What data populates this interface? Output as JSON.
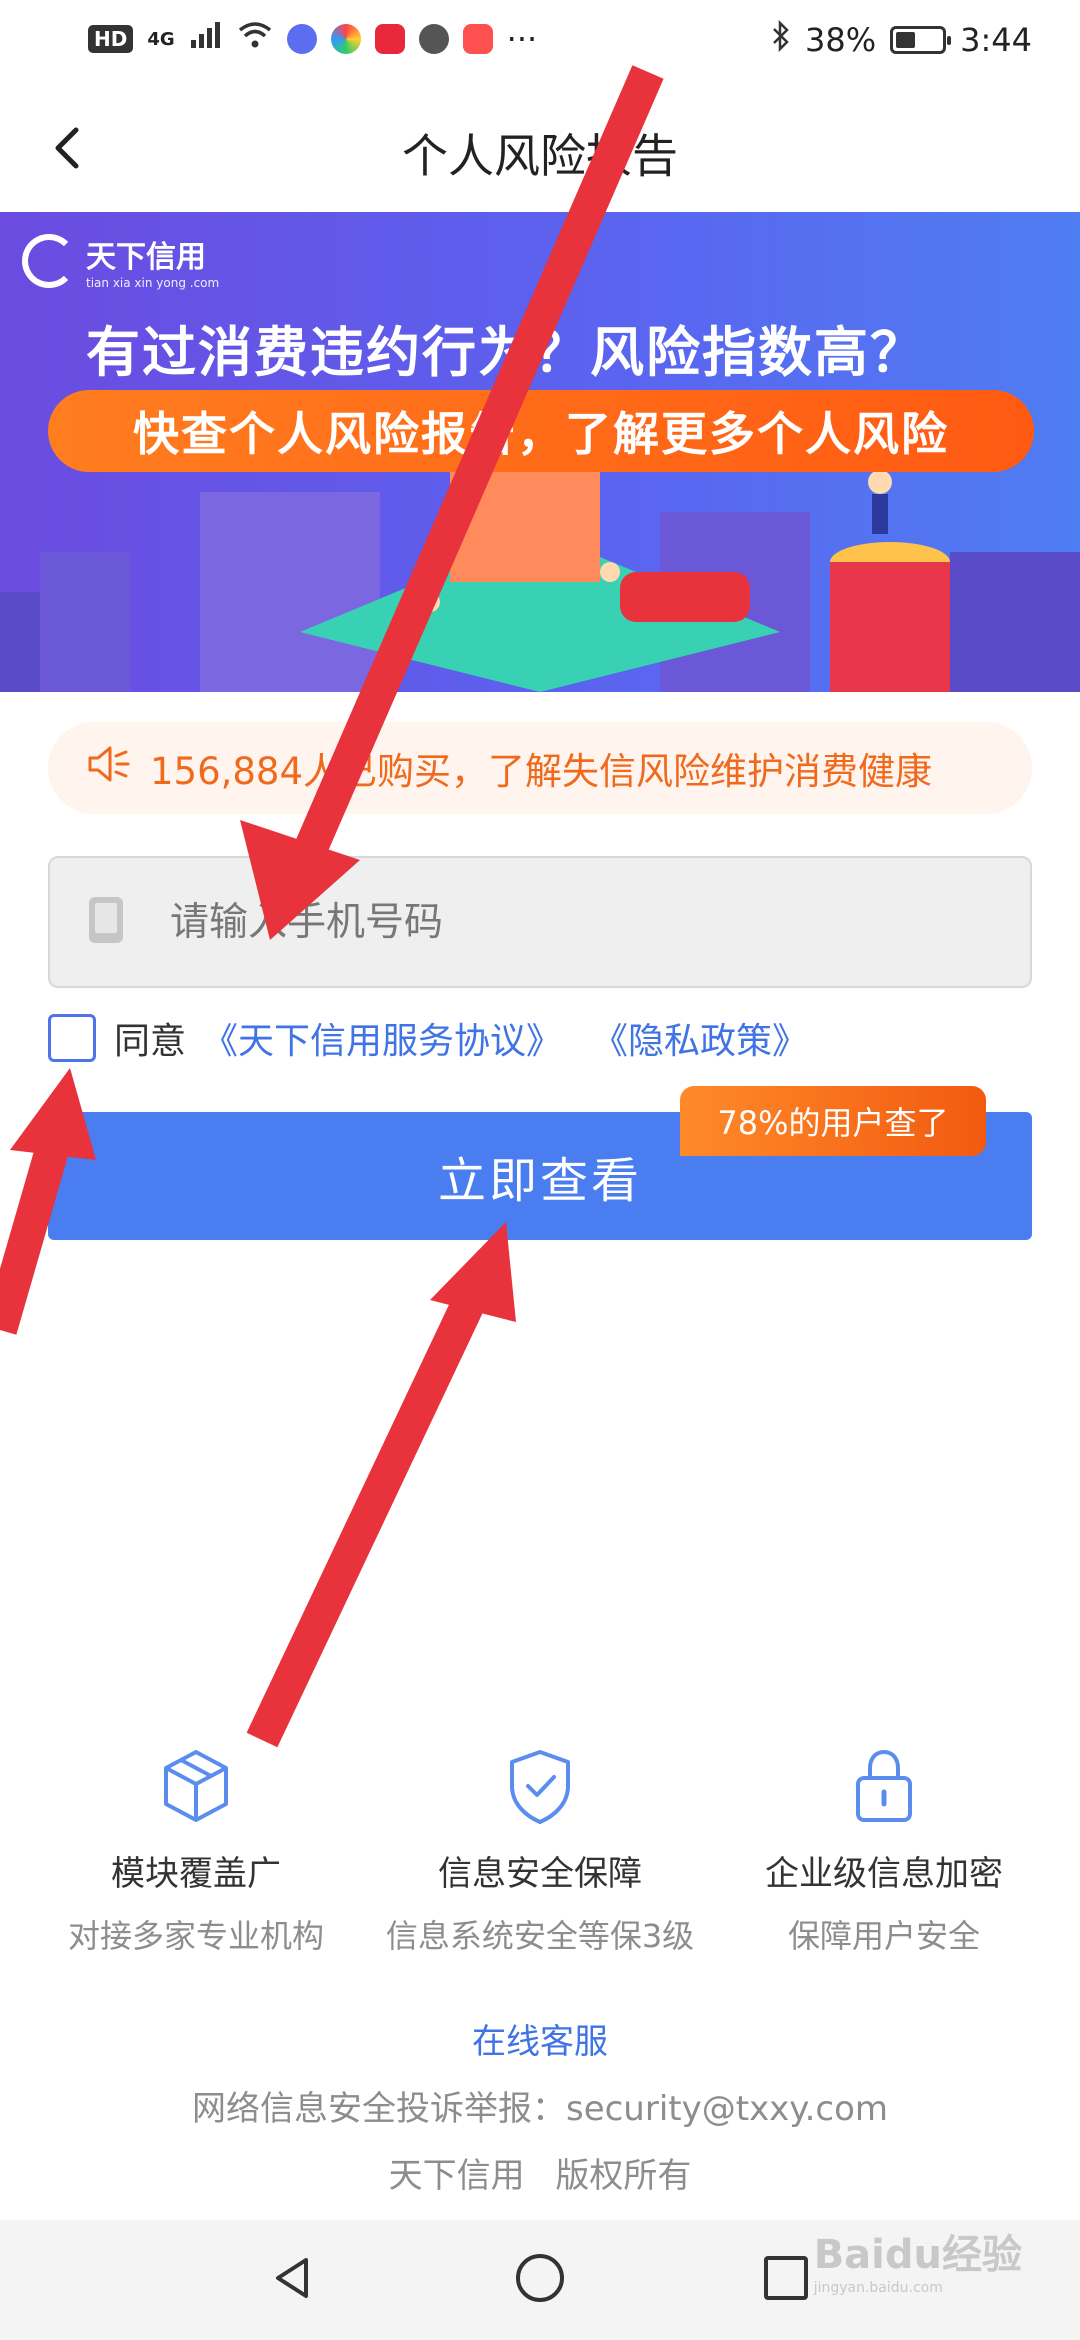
{
  "status_bar": {
    "hd": "HD",
    "network": "4G",
    "more": "···",
    "battery": "38%",
    "time": "3:44"
  },
  "header": {
    "title": "个人风险报告"
  },
  "banner": {
    "logo_name": "天下信用",
    "logo_sub": "tian xia xin yong .com",
    "headline": "有过消费违约行为？风险指数高？",
    "pill": "快查个人风险报告，了解更多个人风险"
  },
  "notice": {
    "text": "156,884人已购买，了解失信风险维护消费健康"
  },
  "form": {
    "phone_placeholder": "请输入手机号码",
    "agree_label": "同意",
    "agreement_link": "《天下信用服务协议》",
    "privacy_link": "《隐私政策》",
    "submit_label": "立即查看",
    "badge": "78%的用户查了"
  },
  "features": [
    {
      "title": "模块覆盖广",
      "desc": "对接多家专业机构"
    },
    {
      "title": "信息安全保障",
      "desc": "信息系统安全等保3级"
    },
    {
      "title": "企业级信息加密",
      "desc": "保障用户安全"
    }
  ],
  "footer": {
    "service": "在线客服",
    "report": "网络信息安全投诉举报：security@txxy.com",
    "copyright": "天下信用 版权所有"
  },
  "watermark": {
    "brand": "Baidu经验",
    "url": "jingyan.baidu.com"
  },
  "colors": {
    "accent": "#4a7df0",
    "orange": "#ff6a1a",
    "arrow": "#e8323c"
  }
}
